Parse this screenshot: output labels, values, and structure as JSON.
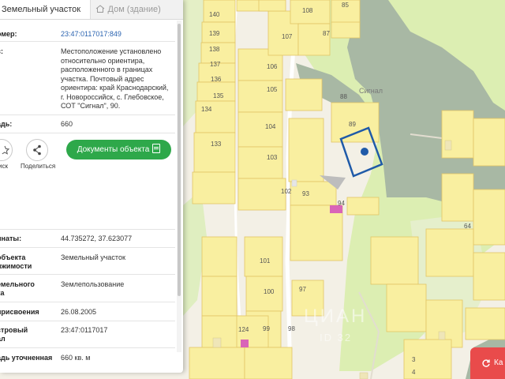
{
  "tabs": [
    {
      "label": "Земельный участок",
      "icon": "land-plot-icon",
      "active": true
    },
    {
      "label": "Дом (здание)",
      "icon": "house-icon",
      "active": false
    }
  ],
  "details": [
    {
      "key": "омер:",
      "value": "23:47:0117017:849",
      "is_link": true
    },
    {
      "key": "с:",
      "value": "Местоположение установлено относительно ориентира, расположенного в границах участка. Почтовый адрес ориентира: край Краснодарский, г. Новороссийск, с. Глебовское, СОТ \"Сигнал\", 90."
    },
    {
      "key": "адь:",
      "value": "660"
    }
  ],
  "actions": {
    "search_label": "иск",
    "share_label": "Поделиться",
    "documents_label": "Документы объекта"
  },
  "details2": [
    {
      "key": "инаты:",
      "value": "44.735272, 37.623077"
    },
    {
      "key": "объекта",
      "key2": "ижимости",
      "value": "Земельный участок"
    },
    {
      "key": "емельного",
      "key2": "ка",
      "value": "Землепользование"
    },
    {
      "key": "присвоения",
      "value": "26.08.2005"
    },
    {
      "key": "стровый",
      "key2": "ал",
      "value": "23:47:0117017"
    },
    {
      "key": "адь уточненная",
      "value": "660 кв. м"
    }
  ],
  "map": {
    "parcel_numbers": [
      "108",
      "85",
      "140",
      "139",
      "107",
      "87",
      "138",
      "106",
      "137",
      "136",
      "135",
      "105",
      "134",
      "88",
      "89",
      "104",
      "133",
      "103",
      "102",
      "93",
      "94",
      "101",
      "97",
      "100",
      "124",
      "99",
      "98",
      "64",
      "3",
      "4"
    ],
    "area_label": "Сигнал",
    "watermark_main": "ЦИАН",
    "watermark_id": "ID 32",
    "colors": {
      "parcel": "#f9efa0",
      "parcel_border": "#e3c766",
      "forest": "#a9b9a4",
      "meadow": "#dceeb0",
      "marker": "#1f5aa8"
    }
  },
  "corner_button": {
    "label": "Ка",
    "icon": "refresh-icon"
  }
}
